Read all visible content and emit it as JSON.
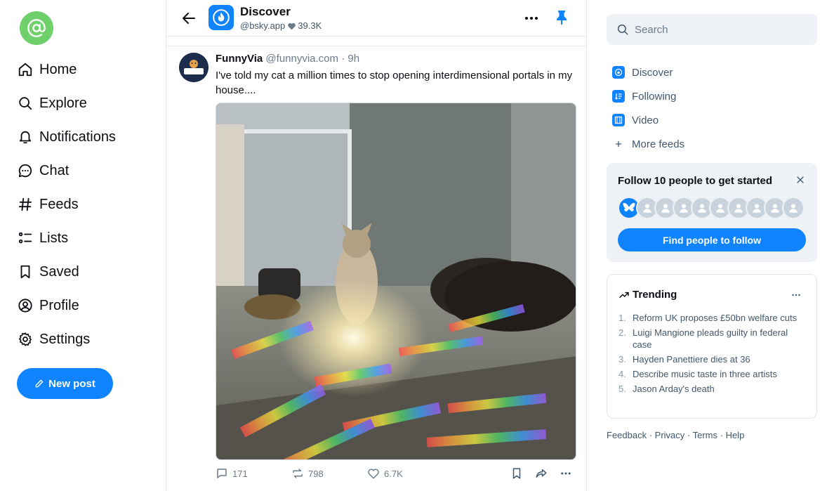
{
  "nav": {
    "items": [
      {
        "label": "Home",
        "icon": "home-icon"
      },
      {
        "label": "Explore",
        "icon": "search-icon"
      },
      {
        "label": "Notifications",
        "icon": "bell-icon"
      },
      {
        "label": "Chat",
        "icon": "chat-icon"
      },
      {
        "label": "Feeds",
        "icon": "hash-icon"
      },
      {
        "label": "Lists",
        "icon": "list-icon"
      },
      {
        "label": "Saved",
        "icon": "bookmark-icon"
      },
      {
        "label": "Profile",
        "icon": "user-circle-icon"
      },
      {
        "label": "Settings",
        "icon": "gear-icon"
      }
    ],
    "new_post_label": "New post"
  },
  "header": {
    "title": "Discover",
    "handle": "@bsky.app",
    "likes": "39.3K"
  },
  "post": {
    "author_name": "FunnyVia",
    "author_handle": "@funnyvia.com",
    "separator": " · ",
    "time": "9h",
    "text": "I've told my cat a million times to stop opening interdimensional portals in my house....",
    "avatar_text": "FunnyVia",
    "replies": "171",
    "reposts": "798",
    "likes": "6.7K"
  },
  "sidebar": {
    "search_placeholder": "Search",
    "feeds": [
      {
        "label": "Discover",
        "icon": "discover-icon"
      },
      {
        "label": "Following",
        "icon": "following-icon"
      },
      {
        "label": "Video",
        "icon": "video-icon"
      },
      {
        "label": "More feeds",
        "icon": "plus-icon"
      }
    ],
    "follow_title": "Follow 10 people to get started",
    "find_button": "Find people to follow",
    "trending_title": "Trending",
    "trending": [
      {
        "num": "1.",
        "text": "Reform UK proposes £50bn welfare cuts"
      },
      {
        "num": "2.",
        "text": "Luigi Mangione pleads guilty in federal case"
      },
      {
        "num": "3.",
        "text": "Hayden Panettiere dies at 36"
      },
      {
        "num": "4.",
        "text": "Describe music taste in three artists"
      },
      {
        "num": "5.",
        "text": "Jason Arday's death"
      }
    ],
    "footer": {
      "feedback": "Feedback",
      "privacy": "Privacy",
      "terms": "Terms",
      "help": "Help",
      "sep": " · "
    }
  },
  "colors": {
    "accent": "#1083fe",
    "avatar_green": "#6fd16c",
    "muted": "#42576c"
  }
}
